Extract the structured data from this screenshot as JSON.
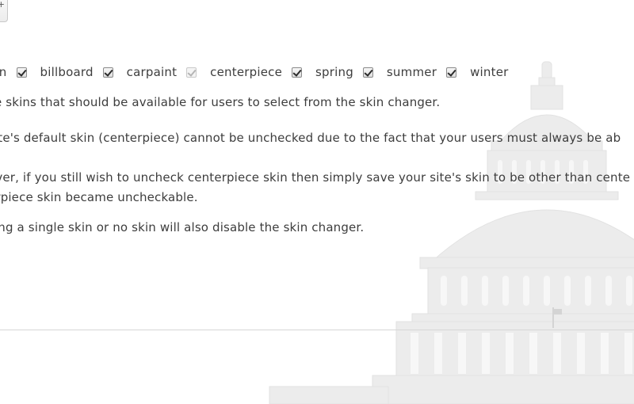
{
  "toolbar": {
    "partial_button_glyph": "+"
  },
  "skins": {
    "items": [
      {
        "label": "autumn",
        "visible_label": "mn",
        "checked": true,
        "disabled": false
      },
      {
        "label": "billboard",
        "checked": true,
        "disabled": false
      },
      {
        "label": "carpaint",
        "checked": true,
        "disabled": false
      },
      {
        "label": "centerpiece",
        "checked": true,
        "disabled": true
      },
      {
        "label": "spring",
        "checked": true,
        "disabled": false
      },
      {
        "label": "summer",
        "checked": true,
        "disabled": false
      },
      {
        "label": "winter",
        "checked": true,
        "disabled": false
      }
    ]
  },
  "help": {
    "line1": "se skins that should be available for users to select from the skin changer.",
    "line2": "site's default skin (centerpiece) cannot be unchecked due to the fact that your users must always be ab",
    "line3a": "ever, if you still wish to uncheck centerpiece skin then simply save your site's skin to be other than cente",
    "line3b": "erpiece skin became uncheckable.",
    "line4": "sing a single skin or no skin will also disable the skin changer."
  }
}
